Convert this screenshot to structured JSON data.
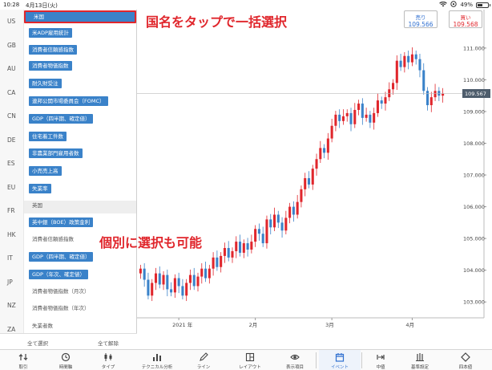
{
  "status": {
    "time": "10:28",
    "date": "4月13日(火)",
    "battery": "49%",
    "battery_level": 0.49
  },
  "countries": [
    "US",
    "GB",
    "AU",
    "CA",
    "CN",
    "DE",
    "ES",
    "EU",
    "FR",
    "HK",
    "IT",
    "JP",
    "NZ",
    "ZA"
  ],
  "indicators": [
    {
      "label": "米国",
      "style": "country-sel"
    },
    {
      "label": "米ADP雇用統計",
      "style": "sel"
    },
    {
      "label": "消費者信頼感指数",
      "style": "sel"
    },
    {
      "label": "消費者物価指数",
      "style": "sel"
    },
    {
      "label": "耐久財受注",
      "style": "sel"
    },
    {
      "label": "連邦公開市場委員会（FOMC）",
      "style": "sel"
    },
    {
      "label": "GDP（四半期、確定値）",
      "style": "sel"
    },
    {
      "label": "住宅着工件数",
      "style": "sel"
    },
    {
      "label": "非農業部門雇用者数",
      "style": "sel"
    },
    {
      "label": "小売売上高",
      "style": "sel"
    },
    {
      "label": "失業率",
      "style": "sel"
    },
    {
      "label": "英国",
      "style": "country-grey"
    },
    {
      "label": "英中銀（BOE）政策金利",
      "style": "sel"
    },
    {
      "label": "消費者信頼感指数",
      "style": "plain"
    },
    {
      "label": "GDP（四半期、確定値）",
      "style": "sel"
    },
    {
      "label": "GDP（年次、確定値）",
      "style": "sel"
    },
    {
      "label": "消費者物価指数（月次）",
      "style": "plain"
    },
    {
      "label": "消費者物価指数（年次）",
      "style": "plain"
    },
    {
      "label": "失業者数",
      "style": "plain"
    }
  ],
  "annotations": {
    "top": "国名をタップで一括選択",
    "middle": "個別に選択も可能"
  },
  "list_actions": {
    "select_all": "全て選択",
    "deselect_all": "全て解除"
  },
  "quotes": {
    "sell": {
      "label": "売り",
      "value": "109.566"
    },
    "buy": {
      "label": "買い",
      "value": "109.568"
    }
  },
  "current_price": "109.567",
  "colors": {
    "up": "#e0262c",
    "down": "#3a82c9",
    "accent": "#2f6fd0",
    "highlight_border": "#e0262c"
  },
  "toolbar": [
    {
      "label": "取引",
      "icon": "trade-arrows-icon"
    },
    {
      "label": "時間軸",
      "icon": "clock-icon"
    },
    {
      "label": "タイプ",
      "icon": "candlestick-icon"
    },
    {
      "label": "テクニカル分析",
      "icon": "bar-chart-icon"
    },
    {
      "label": "ライン",
      "icon": "pen-icon"
    },
    {
      "label": "レイアウト",
      "icon": "layout-icon"
    },
    {
      "label": "表示項目",
      "icon": "eye-icon"
    },
    {
      "label": "イベント",
      "icon": "calendar-icon"
    },
    {
      "label": "中値",
      "icon": "mid-price-icon"
    },
    {
      "label": "基準設定",
      "icon": "settings-icon"
    },
    {
      "label": "四本値",
      "icon": "ohlc-icon"
    }
  ],
  "chart_data": {
    "type": "candlestick",
    "y_ticks": [
      103.0,
      104.0,
      105.0,
      106.0,
      107.0,
      108.0,
      109.0,
      110.0,
      111.0
    ],
    "y_labels": [
      "103.000",
      "104.000",
      "105.000",
      "106.000",
      "107.000",
      "108.000",
      "109.000",
      "110.000",
      "111.000"
    ],
    "ylim": [
      102.5,
      111.35
    ],
    "x_labels": [
      {
        "label": "2021 年",
        "index": 10
      },
      {
        "label": "2月",
        "index": 30
      },
      {
        "label": "3月",
        "index": 50
      },
      {
        "label": "4月",
        "index": 71
      }
    ],
    "closes": [
      104.05,
      103.7,
      103.2,
      103.6,
      103.9,
      103.55,
      103.85,
      103.4,
      103.3,
      103.75,
      103.5,
      103.2,
      103.6,
      103.85,
      103.5,
      103.8,
      104.05,
      103.75,
      104.05,
      104.4,
      104.1,
      104.45,
      104.7,
      104.4,
      104.6,
      104.9,
      104.55,
      104.85,
      104.65,
      104.9,
      105.3,
      105.15,
      104.85,
      105.6,
      105.35,
      105.75,
      105.5,
      105.25,
      105.65,
      106.0,
      105.75,
      106.15,
      106.55,
      106.9,
      106.7,
      107.2,
      107.5,
      107.85,
      107.7,
      108.15,
      108.55,
      108.9,
      108.7,
      108.85,
      108.95,
      108.6,
      109.05,
      109.25,
      108.8,
      108.9,
      108.65,
      108.95,
      109.35,
      109.25,
      109.45,
      109.7,
      109.9,
      110.6,
      110.4,
      110.75,
      110.55,
      110.8,
      110.65,
      110.3,
      109.65,
      109.2,
      109.45,
      109.65,
      109.5,
      109.567
    ]
  }
}
